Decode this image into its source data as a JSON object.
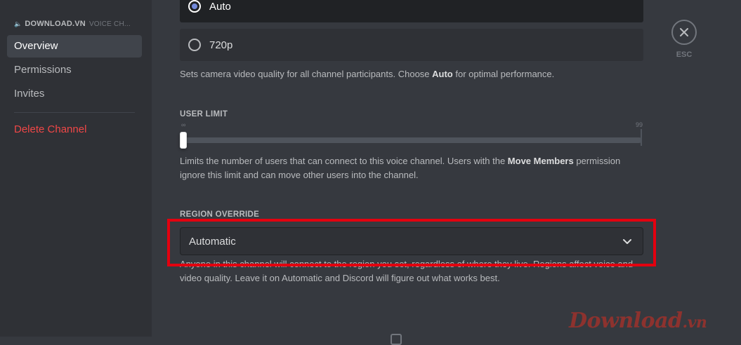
{
  "sidebar": {
    "server_name": "DOWNLOAD.VN",
    "channel_name": "VOICE CH...",
    "items": [
      {
        "label": "Overview",
        "active": true
      },
      {
        "label": "Permissions"
      },
      {
        "label": "Invites"
      }
    ],
    "delete_label": "Delete Channel"
  },
  "video_quality": {
    "options": [
      {
        "label": "Auto",
        "selected": true
      },
      {
        "label": "720p",
        "selected": false
      }
    ],
    "description_pre": "Sets camera video quality for all channel participants. Choose ",
    "description_bold": "Auto",
    "description_post": " for optimal performance."
  },
  "user_limit": {
    "title": "USER LIMIT",
    "min_marker": "∞",
    "max_marker": "99",
    "value": 0,
    "description_pre": "Limits the number of users that can connect to this voice channel. Users with the ",
    "description_bold": "Move Members",
    "description_post": " permission ignore this limit and can move other users into the channel."
  },
  "region_override": {
    "title": "REGION OVERRIDE",
    "selected": "Automatic",
    "description": "Anyone in this channel will connect to the region you set, regardless of where they live. Regions affect voice and video quality. Leave it on Automatic and Discord will figure out what works best."
  },
  "close": {
    "esc_label": "ESC"
  },
  "watermark": {
    "main": "Download",
    "tld": ".vn"
  },
  "colors": {
    "background": "#36393f",
    "sidebar": "#2f3136",
    "danger": "#f04747",
    "radio_accent": "#7289da",
    "highlight": "#e3000f"
  }
}
